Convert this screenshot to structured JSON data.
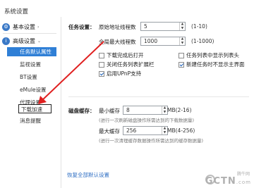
{
  "window": {
    "title": "系统设置"
  },
  "sidebar": {
    "groups": [
      {
        "label": "基本设置",
        "arrow": "›"
      },
      {
        "label": "高级设置",
        "arrow": "⌄"
      }
    ],
    "items": [
      {
        "label": "任务默认属性"
      },
      {
        "label": "监视设置"
      },
      {
        "label": "BT设置"
      },
      {
        "label": "eMule设置"
      },
      {
        "label": "代理设置"
      },
      {
        "label": "下载加速"
      },
      {
        "label": "消息提醒"
      }
    ]
  },
  "task_settings": {
    "label": "任务设置：",
    "orig_threads_label": "原始地址线程数",
    "orig_threads_value": "5",
    "orig_threads_range": "(1-10)",
    "max_tasks_label": "全局最大线程数",
    "max_tasks_value": "1000",
    "max_tasks_range": "(1-1000)",
    "checkboxes": [
      {
        "label": "下载完成后打开",
        "checked": false
      },
      {
        "label": "任务列表中显示列表头",
        "checked": false
      },
      {
        "label": "关闭任务列表扩展栏",
        "checked": false
      },
      {
        "label": "新建任务时不显示主界面",
        "checked": true
      },
      {
        "label": "启用UPnP支持",
        "checked": true
      }
    ]
  },
  "disk_cache": {
    "label": "磁盘缓存：",
    "min_label": "最小缓存",
    "min_value": "8",
    "min_range": "MB(2-16)",
    "min_note": "(进行一次刷新磁盘操作所需达到的下载数据量)",
    "max_label": "最大缓存",
    "max_value": "256",
    "max_range": "MB(4-256)",
    "max_note": "(进行一次清理缓存数据操作所需达到的缓存数据量)"
  },
  "footer": {
    "restore_link": "恢复全部默认设置"
  },
  "watermark": {
    "main": "GCTN",
    "sub": "腾牛网",
    "dotcom": ".com"
  },
  "annotation": {
    "arrow_color": "#e02020"
  }
}
